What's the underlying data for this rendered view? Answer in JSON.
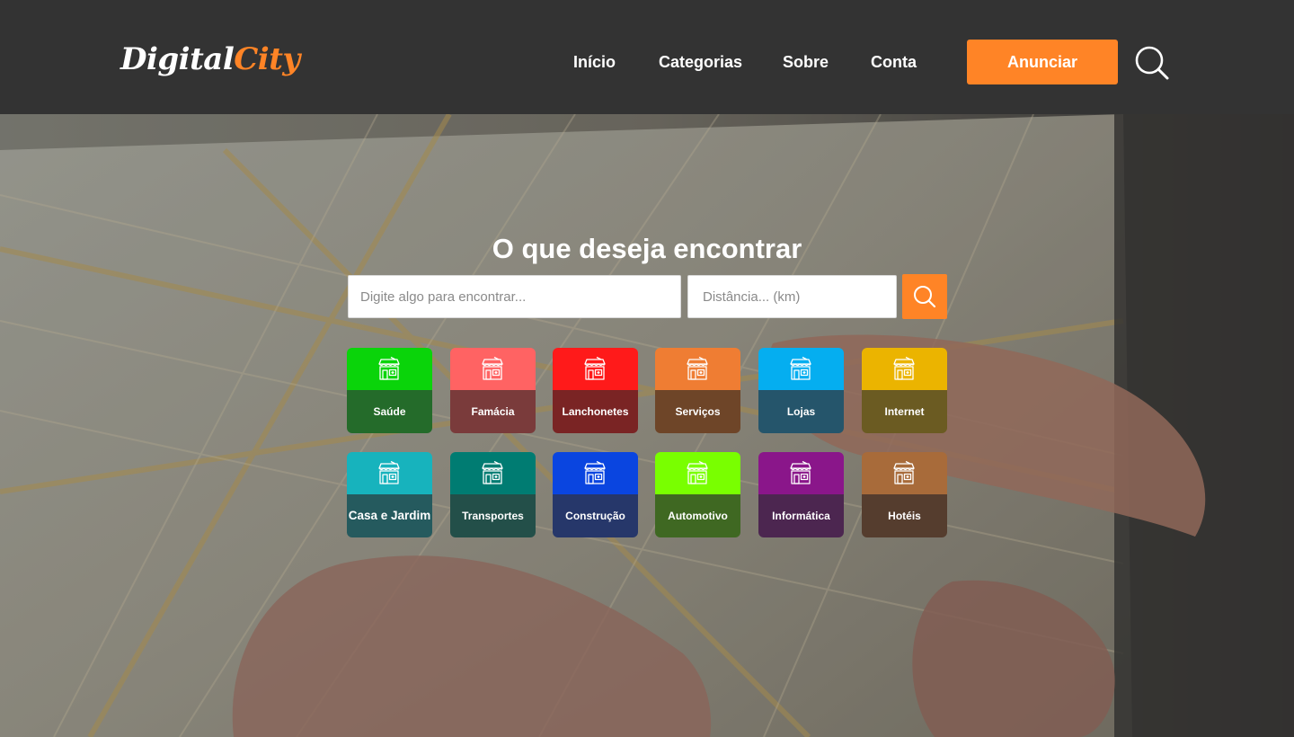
{
  "brand": {
    "part1": "Digital",
    "part2": "City"
  },
  "nav": {
    "items": [
      "Início",
      "Categorias",
      "Sobre",
      "Conta"
    ],
    "cta_label": "Anunciar"
  },
  "colors": {
    "accent": "#ff8426",
    "header_bg": "#333333"
  },
  "hero": {
    "title": "O que deseja encontrar",
    "search_placeholder": "Digite algo para encontrar...",
    "distance_placeholder": "Distância... (km)",
    "search_button_icon": "search-icon"
  },
  "categories": [
    {
      "label": "Saúde",
      "top": "#0ad40a",
      "bottom": "#246b2a",
      "icon": "store-icon"
    },
    {
      "label": "Famácia",
      "top": "#ff6363",
      "bottom": "#7a3b3b",
      "icon": "store-icon"
    },
    {
      "label": "Lanchonetes",
      "top": "#ff1a1a",
      "bottom": "#7a2424",
      "icon": "store-icon"
    },
    {
      "label": "Serviços",
      "top": "#ef7d33",
      "bottom": "#6e4528",
      "icon": "store-icon"
    },
    {
      "label": "Lojas",
      "top": "#05aef0",
      "bottom": "#25556b",
      "icon": "store-icon"
    },
    {
      "label": "Internet",
      "top": "#ebb400",
      "bottom": "#6b5b22",
      "icon": "store-icon"
    },
    {
      "label": "Casa e Jardim",
      "top": "#17b3bd",
      "bottom": "#255a5e",
      "icon": "store-icon"
    },
    {
      "label": "Transportes",
      "top": "#007c72",
      "bottom": "#234f49",
      "icon": "store-icon"
    },
    {
      "label": "Construção",
      "top": "#0a45e0",
      "bottom": "#26376a",
      "icon": "store-icon"
    },
    {
      "label": "Automotivo",
      "top": "#79ff00",
      "bottom": "#3f6822",
      "icon": "store-icon"
    },
    {
      "label": "Informática",
      "top": "#8a168a",
      "bottom": "#4c2650",
      "icon": "store-icon"
    },
    {
      "label": "Hotéis",
      "top": "#a86b3a",
      "bottom": "#553d2e",
      "icon": "store-icon"
    }
  ]
}
